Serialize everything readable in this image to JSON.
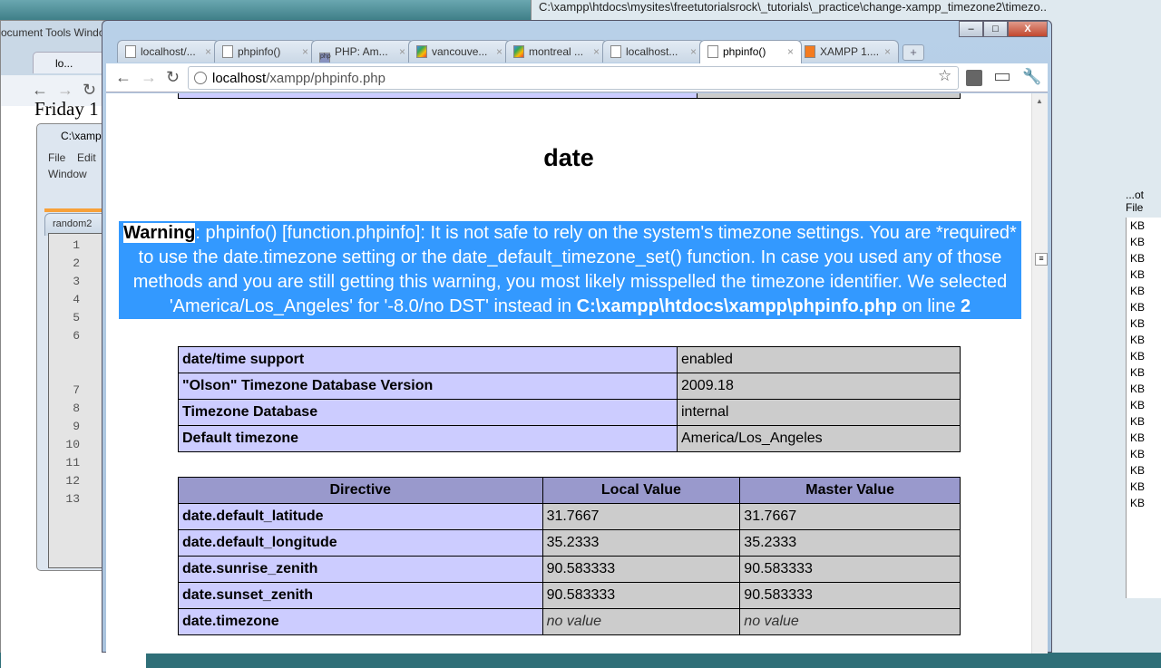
{
  "background": {
    "right_window_title": "C:\\xampp\\htdocs\\mysites\\freetutorialsrock\\_tutorials\\_practice\\change-xampp_timezone2\\timezo...",
    "right_window_button": "...ot File",
    "right_window_sizes": [
      "KB",
      "KB",
      "KB",
      "KB",
      "KB",
      "KB",
      "KB",
      "KB",
      "KB",
      "KB",
      "KB",
      "KB",
      "KB",
      "KB",
      "KB",
      "KB",
      "KB",
      "KB"
    ],
    "left_menu": "ocument   Tools   Window   Help",
    "left_tab": "lo...",
    "left_page_text": "Friday 1",
    "editor": {
      "title": "C:\\xamp",
      "menu": [
        "File",
        "Edit",
        "Window"
      ],
      "file_tab": "random2",
      "line_numbers": [
        "1",
        "2",
        "3",
        "4",
        "5",
        "6",
        "7",
        "8",
        "9",
        "10",
        "11",
        "12",
        "13"
      ]
    }
  },
  "browser": {
    "tabs": [
      {
        "label": "localhost/...",
        "icon": "page-icon"
      },
      {
        "label": "phpinfo()",
        "icon": "page-icon"
      },
      {
        "label": "PHP: Am...",
        "icon": "php-icon"
      },
      {
        "label": "vancouve...",
        "icon": "google-maps-icon"
      },
      {
        "label": "montreal ...",
        "icon": "google-maps-icon"
      },
      {
        "label": "localhost...",
        "icon": "page-icon"
      },
      {
        "label": "phpinfo()",
        "icon": "page-icon",
        "active": true
      },
      {
        "label": "XAMPP 1....",
        "icon": "xampp-icon"
      }
    ],
    "url_host": "localhost",
    "url_path": "/xampp/phpinfo.php"
  },
  "page": {
    "heading": "date",
    "warning": {
      "label": "Warning",
      "message": ": phpinfo() [function.phpinfo]: It is not safe to rely on the system's timezone settings. You are *required* to use the date.timezone setting or the date_default_timezone_set() function. In case you used any of those methods and you are still getting this warning, you most likely misspelled the timezone identifier. We selected 'America/Los_Angeles' for '-8.0/no DST' instead in ",
      "file": "C:\\xampp\\htdocs\\xampp\\phpinfo.php",
      "on_line": " on line ",
      "line": "2"
    },
    "info_table": [
      [
        "date/time support",
        "enabled"
      ],
      [
        "\"Olson\" Timezone Database Version",
        "2009.18"
      ],
      [
        "Timezone Database",
        "internal"
      ],
      [
        "Default timezone",
        "America/Los_Angeles"
      ]
    ],
    "directive_table": {
      "headers": [
        "Directive",
        "Local Value",
        "Master Value"
      ],
      "rows": [
        [
          "date.default_latitude",
          "31.7667",
          "31.7667"
        ],
        [
          "date.default_longitude",
          "35.2333",
          "35.2333"
        ],
        [
          "date.sunrise_zenith",
          "90.583333",
          "90.583333"
        ],
        [
          "date.sunset_zenith",
          "90.583333",
          "90.583333"
        ],
        [
          "date.timezone",
          "no value",
          "no value"
        ]
      ]
    }
  }
}
